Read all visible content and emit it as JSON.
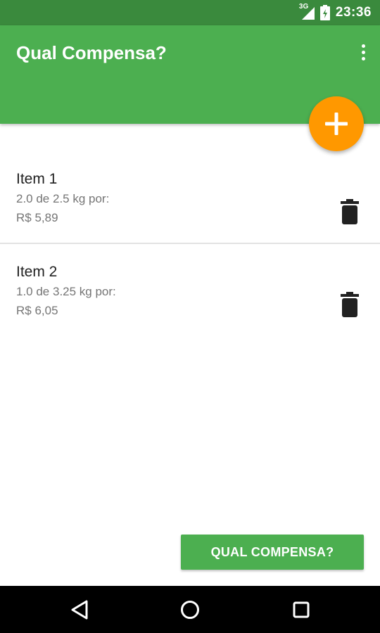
{
  "status_bar": {
    "network_label": "3G",
    "time": "23:36"
  },
  "app_bar": {
    "title": "Qual Compensa?",
    "color": "#4caf50",
    "status_color": "#3a8a3d"
  },
  "fab": {
    "icon": "plus-icon",
    "color": "#ff9800"
  },
  "items": [
    {
      "name": "Item 1",
      "detail": "2.0 de 2.5 kg por:",
      "price": "R$ 5,89",
      "delete_icon": "trash-icon"
    },
    {
      "name": "Item 2",
      "detail": "1.0 de 3.25 kg por:",
      "price": "R$ 6,05",
      "delete_icon": "trash-icon"
    }
  ],
  "action_button": {
    "label": "QUAL COMPENSA?"
  },
  "nav_bar": {
    "back_icon": "back-triangle-icon",
    "home_icon": "home-circle-icon",
    "recents_icon": "recents-square-icon"
  }
}
